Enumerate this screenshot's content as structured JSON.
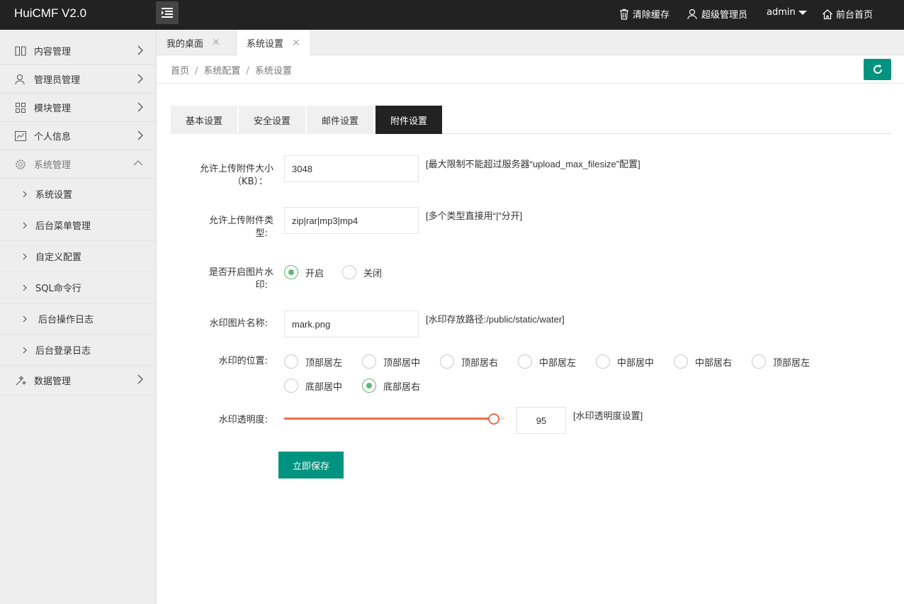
{
  "app": {
    "title": "HuiCMF V2.0"
  },
  "header": {
    "clear_cache": "清除缓存",
    "role": "超级管理员",
    "user": "admin",
    "frontend": "前台首页"
  },
  "sidebar": {
    "items": [
      {
        "label": "内容管理",
        "icon": "book-icon"
      },
      {
        "label": "管理员管理",
        "icon": "user-icon"
      },
      {
        "label": "模块管理",
        "icon": "grid-icon"
      },
      {
        "label": "个人信息",
        "icon": "chart-icon"
      },
      {
        "label": "系统管理",
        "icon": "gear-icon"
      }
    ],
    "sub_items": [
      "系统设置",
      "后台菜单管理",
      "自定义配置",
      "SQL命令行",
      "后台操作日志",
      "后台登录日志"
    ],
    "last_item": {
      "label": "数据管理",
      "icon": "magic-icon"
    }
  },
  "tabs": [
    {
      "label": "我的桌面"
    },
    {
      "label": "系统设置"
    }
  ],
  "breadcrumb": [
    "首页",
    "系统配置",
    "系统设置"
  ],
  "form_tabs": [
    "基本设置",
    "安全设置",
    "邮件设置",
    "附件设置"
  ],
  "form": {
    "size_label_1": "允许上传附件大小",
    "size_label_2": "（KB）：",
    "size_value": "3048",
    "size_hint": "[最大限制不能超过服务器“upload_max_filesize”配置]",
    "type_label_1": "允许上传附件类",
    "type_label_2": "型:",
    "type_value": "zip|rar|mp3|mp4",
    "type_hint": "[多个类型直接用“|”分开]",
    "wm_label_1": "是否开启图片水",
    "wm_label_2": "印:",
    "wm_on": "开启",
    "wm_off": "关闭",
    "name_label": "水印图片名称:",
    "name_value": "mark.png",
    "name_hint": "[水印存放路径:/public/static/water]",
    "pos_label": "水印的位置:",
    "positions": [
      "顶部居左",
      "顶部居中",
      "顶部居右",
      "中部居左",
      "中部居中",
      "中部居右",
      "顶部居左",
      "底部居中",
      "底部居右"
    ],
    "alpha_label": "水印透明度:",
    "alpha_value": "95",
    "alpha_fraction": 0.95,
    "alpha_hint": "[水印透明度设置]",
    "save": "立即保存"
  },
  "colors": {
    "accent": "#00937f",
    "slider": "#ed6d45",
    "radio": "#5fb878",
    "header": "#222222"
  }
}
